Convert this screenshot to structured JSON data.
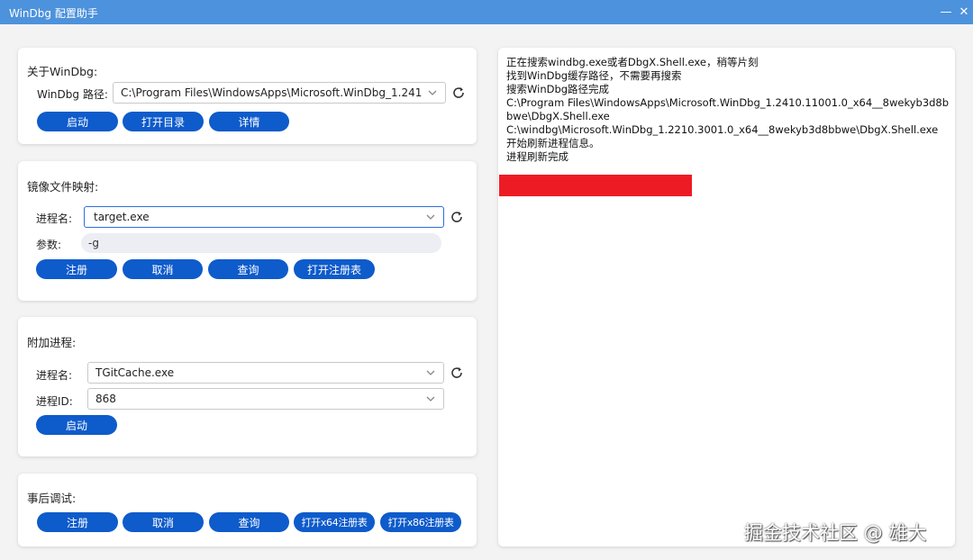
{
  "window": {
    "title": "WinDbg 配置助手",
    "minimize_glyph": "—",
    "close_glyph": "✕"
  },
  "about": {
    "title": "关于WinDbg:",
    "path_label": "WinDbg 路径:",
    "path_value": "C:\\Program Files\\WindowsApps\\Microsoft.WinDbg_1.2410.11001.0_x64__8wekyb3d8bbwe\\DbgX.Shell.exe",
    "buttons": {
      "launch": "启动",
      "open_dir": "打开目录",
      "details": "详情"
    }
  },
  "ifeo": {
    "title": "镜像文件映射:",
    "process_label": "进程名:",
    "process_value": "target.exe",
    "args_label": "参数:",
    "args_value": "-g",
    "buttons": {
      "register": "注册",
      "cancel": "取消",
      "query": "查询",
      "open_registry": "打开注册表"
    }
  },
  "attach": {
    "title": "附加进程:",
    "process_label": "进程名:",
    "process_value": "TGitCache.exe",
    "pid_label": "进程ID:",
    "pid_value": "868",
    "buttons": {
      "launch": "启动"
    }
  },
  "postmortem": {
    "title": "事后调试:",
    "buttons": {
      "register": "注册",
      "cancel": "取消",
      "query": "查询",
      "open_x64": "打开x64注册表",
      "open_x86": "打开x86注册表"
    }
  },
  "log": {
    "lines": [
      "正在搜索windbg.exe或者DbgX.Shell.exe，稍等片刻",
      "找到WinDbg缓存路径，不需要再搜索",
      "搜索WinDbg路径完成",
      "C:\\Program Files\\WindowsApps\\Microsoft.WinDbg_1.2410.11001.0_x64__8wekyb3d8bbwe\\DbgX.Shell.exe",
      "C:\\windbg\\Microsoft.WinDbg_1.2210.3001.0_x64__8wekyb3d8bbwe\\DbgX.Shell.exe",
      "开始刷新进程信息。",
      "进程刷新完成"
    ]
  },
  "watermark": "掘金技术社区 @ 雄大",
  "colors": {
    "titlebar": "#4d92dc",
    "button": "#0e5bcb",
    "redaction": "#ed1c24"
  }
}
